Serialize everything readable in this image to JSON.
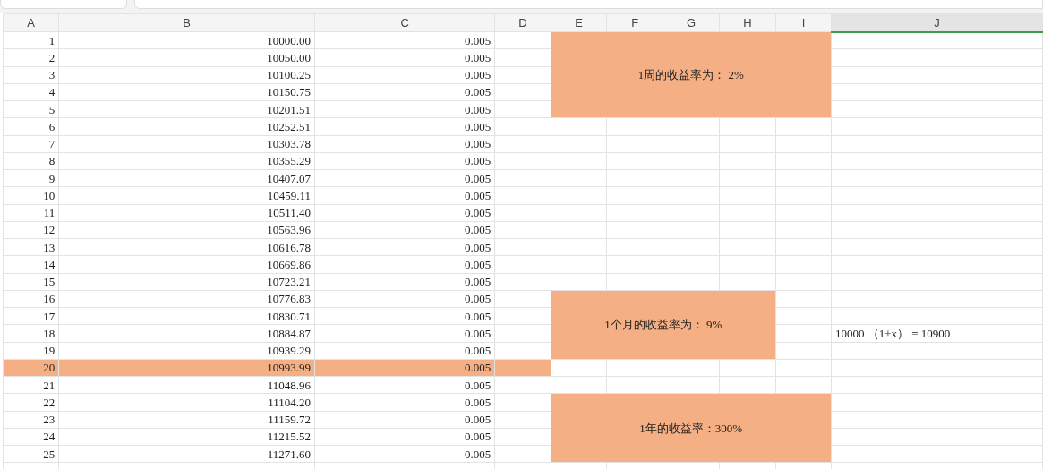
{
  "columns": [
    {
      "label": "A",
      "selected": false
    },
    {
      "label": "B",
      "selected": false
    },
    {
      "label": "C",
      "selected": false
    },
    {
      "label": "D",
      "selected": false
    },
    {
      "label": "E",
      "selected": false
    },
    {
      "label": "F",
      "selected": false
    },
    {
      "label": "G",
      "selected": false
    },
    {
      "label": "H",
      "selected": false
    },
    {
      "label": "I",
      "selected": false
    },
    {
      "label": "J",
      "selected": true
    }
  ],
  "rows": [
    {
      "a": "1",
      "b": "10000.00",
      "c": "0.005",
      "highlighted": false
    },
    {
      "a": "2",
      "b": "10050.00",
      "c": "0.005",
      "highlighted": false
    },
    {
      "a": "3",
      "b": "10100.25",
      "c": "0.005",
      "highlighted": false
    },
    {
      "a": "4",
      "b": "10150.75",
      "c": "0.005",
      "highlighted": false
    },
    {
      "a": "5",
      "b": "10201.51",
      "c": "0.005",
      "highlighted": false
    },
    {
      "a": "6",
      "b": "10252.51",
      "c": "0.005",
      "highlighted": false
    },
    {
      "a": "7",
      "b": "10303.78",
      "c": "0.005",
      "highlighted": false
    },
    {
      "a": "8",
      "b": "10355.29",
      "c": "0.005",
      "highlighted": false
    },
    {
      "a": "9",
      "b": "10407.07",
      "c": "0.005",
      "highlighted": false
    },
    {
      "a": "10",
      "b": "10459.11",
      "c": "0.005",
      "highlighted": false
    },
    {
      "a": "11",
      "b": "10511.40",
      "c": "0.005",
      "highlighted": false
    },
    {
      "a": "12",
      "b": "10563.96",
      "c": "0.005",
      "highlighted": false
    },
    {
      "a": "13",
      "b": "10616.78",
      "c": "0.005",
      "highlighted": false
    },
    {
      "a": "14",
      "b": "10669.86",
      "c": "0.005",
      "highlighted": false
    },
    {
      "a": "15",
      "b": "10723.21",
      "c": "0.005",
      "highlighted": false
    },
    {
      "a": "16",
      "b": "10776.83",
      "c": "0.005",
      "highlighted": false
    },
    {
      "a": "17",
      "b": "10830.71",
      "c": "0.005",
      "highlighted": false
    },
    {
      "a": "18",
      "b": "10884.87",
      "c": "0.005",
      "highlighted": false
    },
    {
      "a": "19",
      "b": "10939.29",
      "c": "0.005",
      "highlighted": false
    },
    {
      "a": "20",
      "b": "10993.99",
      "c": "0.005",
      "highlighted": true
    },
    {
      "a": "21",
      "b": "11048.96",
      "c": "0.005",
      "highlighted": false
    },
    {
      "a": "22",
      "b": "11104.20",
      "c": "0.005",
      "highlighted": false
    },
    {
      "a": "23",
      "b": "11159.72",
      "c": "0.005",
      "highlighted": false
    },
    {
      "a": "24",
      "b": "11215.52",
      "c": "0.005",
      "highlighted": false
    },
    {
      "a": "25",
      "b": "11271.60",
      "c": "0.005",
      "highlighted": false
    }
  ],
  "notes": [
    {
      "text": "1周的收益率为：  2%"
    },
    {
      "text": "1个月的收益率为：  9%"
    },
    {
      "text": "1年的收益率：300%"
    }
  ],
  "formula_note": "10000 （1+x） = 10900"
}
